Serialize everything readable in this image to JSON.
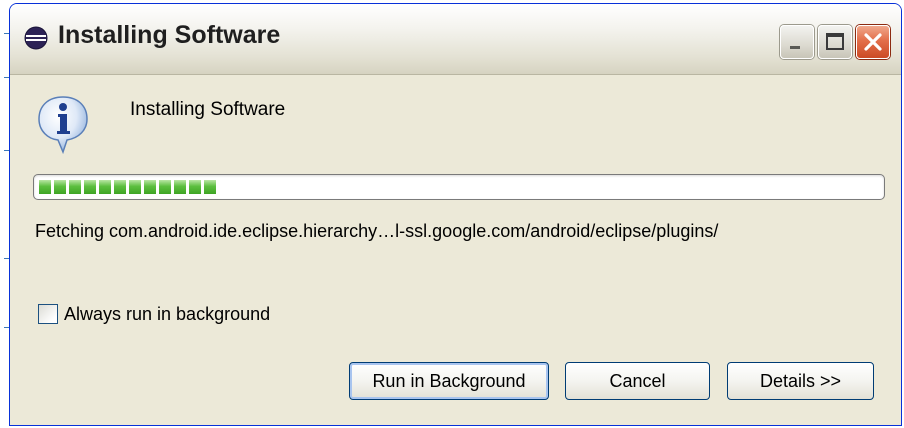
{
  "window": {
    "title": "Installing Software",
    "controls": {
      "minimize": "minimize-icon",
      "maximize": "maximize-icon",
      "close": "close-icon"
    }
  },
  "dialog": {
    "icon": "info-icon",
    "heading": "Installing Software",
    "progress_fraction": 0.22,
    "status_text": "Fetching com.android.ide.eclipse.hierarchy…l-ssl.google.com/android/eclipse/plugins/",
    "checkbox": {
      "label": "Always run in background",
      "checked": false
    },
    "buttons": {
      "run_in_background": "Run in Background",
      "cancel": "Cancel",
      "details": "Details >>"
    }
  },
  "colors": {
    "title_bar": "#ece9d8",
    "progress_green": "#4fb832",
    "close_button": "#d9552f",
    "window_border": "#0831d9"
  }
}
